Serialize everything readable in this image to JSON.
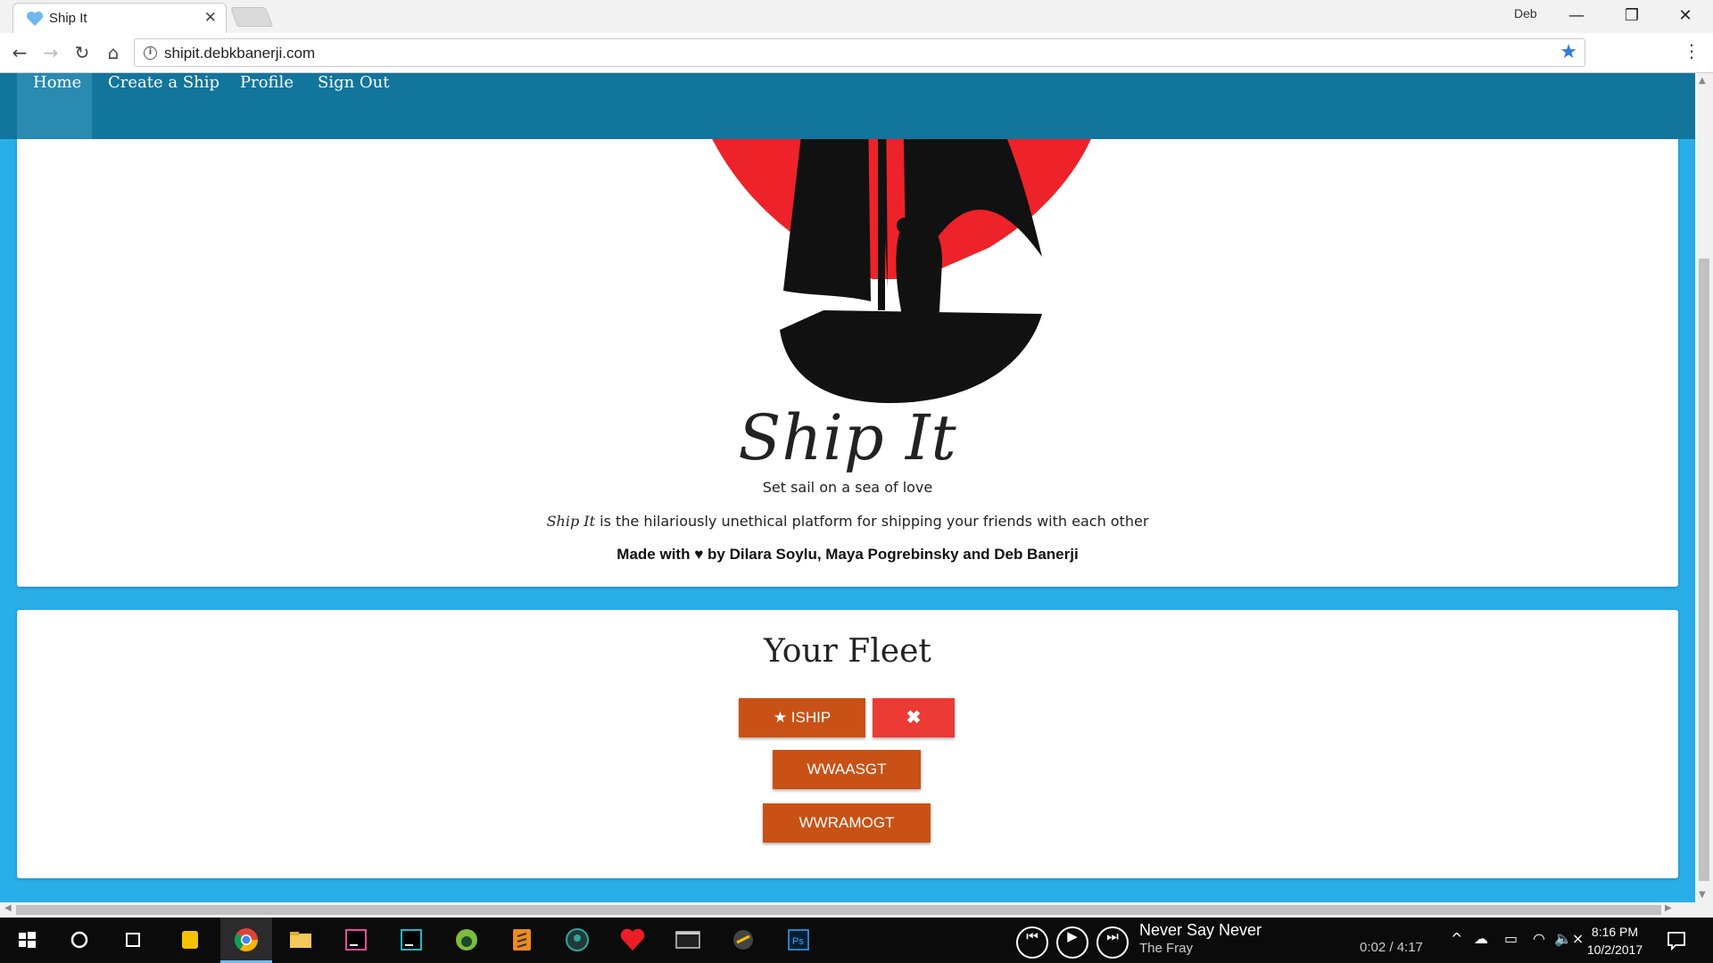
{
  "browser": {
    "tab_title": "Ship It",
    "tab_close": "✕",
    "profile_name": "Deb",
    "url": "shipit.debkbanerji.com",
    "window_controls": {
      "minimize": "—",
      "restore": "❐",
      "close": "✕"
    },
    "nav_icons": {
      "back": "←",
      "forward": "→",
      "reload": "↻",
      "home": "⌂",
      "star": "★",
      "menu": "⋮",
      "info": "i"
    }
  },
  "navbar": {
    "items": [
      {
        "label": "Home",
        "active": true
      },
      {
        "label": "Create a Ship",
        "active": false
      },
      {
        "label": "Profile",
        "active": false
      },
      {
        "label": "Sign Out",
        "active": false
      }
    ]
  },
  "hero": {
    "title": "Ship It",
    "tagline": "Set sail on a sea of love",
    "description_em": "Ship It",
    "description_rest": " is the hilariously unethical platform for shipping your friends with each other",
    "credits": "Made with ♥ by Dilara Soylu, Maya Pogrebinsky and Deb Banerji"
  },
  "fleet": {
    "title": "Your Fleet",
    "ships": [
      {
        "label": "ISHIP",
        "starred": true,
        "star_glyph": "★"
      },
      {
        "label": "WWAASGT"
      },
      {
        "label": "WWRAMOGT"
      }
    ],
    "delete_glyph": "✖"
  },
  "taskbar": {
    "now_playing": {
      "title": "Never Say Never",
      "artist": "The Fray",
      "time": "0:02 / 4:17"
    },
    "media_glyphs": {
      "prev": "⏮",
      "play": "▶",
      "next": "⏭"
    },
    "tray_glyphs": {
      "chevron": "^",
      "cloud": "☁",
      "battery": "▭",
      "wifi": "◠",
      "volume": "🔈×"
    },
    "clock_time": "8:16 PM",
    "clock_date": "10/2/2017"
  },
  "colors": {
    "navbar": "#12759c",
    "page_bg": "#29aee8",
    "ship_button": "#c95115",
    "delete_button": "#ec3a35",
    "heart_red": "#ee2229"
  }
}
